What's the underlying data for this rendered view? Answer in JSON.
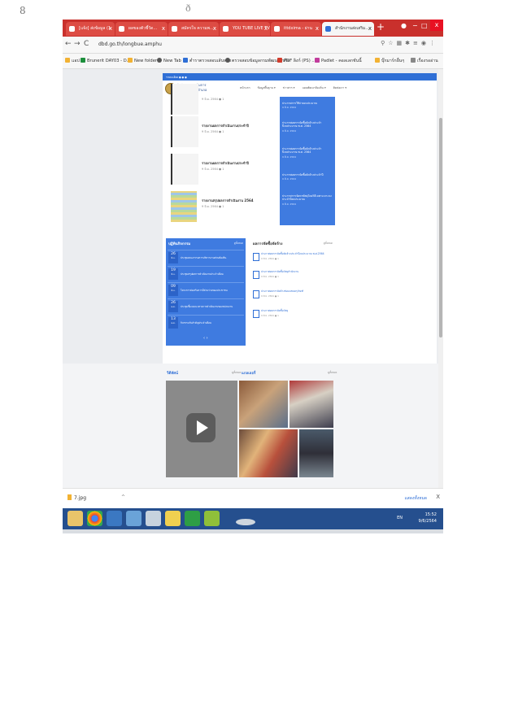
{
  "page_marks": {
    "top_left": "8",
    "top_center": "ð"
  },
  "browser": {
    "tabs": [
      {
        "label": "[แจ้ง] ส่งข้อมูล (1"
      },
      {
        "label": "ผลของตัวชี้วัด..."
      },
      {
        "label": "สมัครใจ ความพ..."
      },
      {
        "label": "YOU TUBE LIVE TV"
      },
      {
        "label": "ittdxima - ผ่าน"
      },
      {
        "label": "สำนักงานส่งเสริม..."
      }
    ],
    "new_tab": "+",
    "minimize": "−",
    "restore": "□",
    "close": "x",
    "url": "dbd.go.th/longbue.amphu",
    "nav": {
      "back": "←",
      "forward": "→",
      "reload": "C"
    },
    "bookmarks": [
      "แอป",
      "Brunerit DAY03 - D...",
      "New folder",
      "New Tab",
      "ตำราตรวจสอบเส้นทาง",
      "ตรวจสอบข้อมูลกรมพัฒนาธุรกิจ",
      "PDF ลิงก์ (PS) ...",
      "Padlet - คอลเลกชันนี้",
      "บุ๊กมาร์กอื่นๆ",
      "เรื่องรออ่าน"
    ]
  },
  "site": {
    "top_strip": "รายละเอียด ● ● ●",
    "logo_text": "สำนักงานส่งเสริมการปกครองท้องถิ่นอำเภอ",
    "menu": [
      "หน้าแรก",
      "ข้อมูลพื้นฐาน ▾",
      "ข่าวสาร ▾",
      "แผนพัฒนาท้องถิ่น ▾",
      "ติดต่อเรา ▾"
    ]
  },
  "documents": [
    {
      "title": "",
      "meta": "9 มิ.ย. 2564     ● 1"
    },
    {
      "title": "รายงานผลการดำเนินงานประจำปี",
      "meta": "9 มิ.ย. 2564     ● 1"
    },
    {
      "title": "รายงานผลการดำเนินงานประจำปี",
      "meta": "9 มิ.ย. 2564     ● 1"
    },
    {
      "title": "รายงานสรุปผลการดำเนินงาน 2564",
      "meta": "9 มิ.ย. 2564     ● 1"
    }
  ],
  "blue_list": [
    {
      "title": "ประกาศการใช้จ่ายงบประมาณ",
      "sub": "9 มิ.ย. 2564"
    },
    {
      "title": "ประกาศผลการจัดซื้อจัดจ้างประจำปีงบประมาณ พ.ศ. 2564",
      "sub": "9 มิ.ย. 2564"
    },
    {
      "title": "ประกาศผลการจัดซื้อจัดจ้างประจำปีงบประมาณ พ.ศ. 2564",
      "sub": "9 มิ.ย. 2564"
    },
    {
      "title": "ประกาศผลการจัดซื้อจัดจ้างประจำปี",
      "sub": "9 มิ.ย. 2564"
    },
    {
      "title": "ประกาศการจัดหาพัสดุโดยวิธีเฉพาะเจาะจง ประจำปีงบประมาณ",
      "sub": "9 มิ.ย. 2564"
    }
  ],
  "news": {
    "heading": "ปฏิทินกิจกรรม",
    "more": "ดูทั้งหมด",
    "items": [
      {
        "day": "26",
        "month": "มิ.ย.",
        "text": "ประชุมคณะกรรมการบริหารงานส่วนท้องถิ่น"
      },
      {
        "day": "19",
        "month": "มิ.ย.",
        "text": "ประชุมสรุปผลการดำเนินงานประจำเดือน"
      },
      {
        "day": "09",
        "month": "มิ.ย.",
        "text": "โครงการส่งเสริมการมีส่วนร่วมของประชาชน"
      },
      {
        "day": "26",
        "month": "พ.ค.",
        "text": "ประชุมชี้แจงแนวทางการดำเนินงานของหน่วยงาน"
      },
      {
        "day": "13",
        "month": "พ.ค.",
        "text": "กิจกรรมวันสำคัญประจำเดือน"
      }
    ],
    "pager": "‹  ›"
  },
  "procure": {
    "heading": "ผลการจัดซื้อจัดจ้าง",
    "more": "ดูทั้งหมด",
    "items": [
      {
        "title": "ประกาศผลการจัดซื้อจัดจ้างประจำปีงบประมาณ พ.ศ.2564",
        "meta": "9 มิ.ย. 2564  ● 1"
      },
      {
        "title": "ประกาศผลการจัดซื้อวัสดุสำนักงาน",
        "meta": "9 มิ.ย. 2564  ● 1"
      },
      {
        "title": "ประกาศผลการจัดจ้างซ่อมแซมครุภัณฑ์",
        "meta": "9 มิ.ย. 2564  ● 1"
      },
      {
        "title": "ประกาศผลการจัดซื้อวัสดุ",
        "meta": "9 มิ.ย. 2564  ● 1"
      }
    ]
  },
  "media": {
    "video_heading": "วีดีทัศน์",
    "video_more": "ดูทั้งหมด",
    "gallery_heading": "แกลเลอรี่",
    "gallery_more": "ดูทั้งหมด"
  },
  "download": {
    "file": "7.jpg",
    "show_all": "แสดงทั้งหมด",
    "close": "X"
  },
  "taskbar": {
    "tray": "EN",
    "time": "15:52",
    "date": "9/6/2564"
  }
}
